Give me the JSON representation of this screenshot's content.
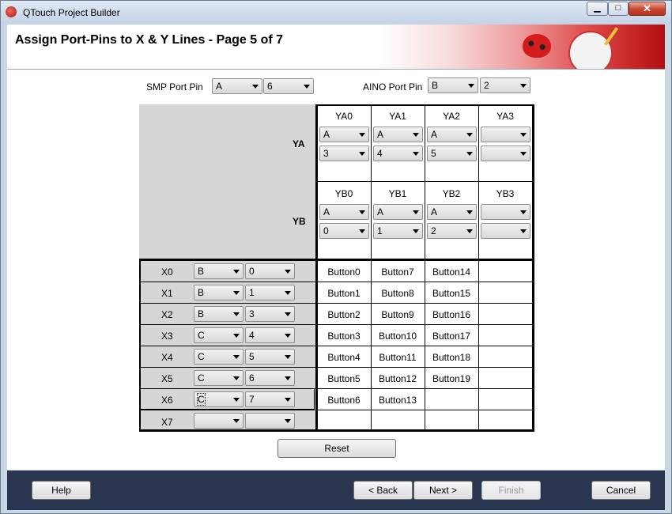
{
  "window": {
    "title": "QTouch Project Builder",
    "minimize": "▁",
    "maximize": "□",
    "close": "✕"
  },
  "header": {
    "title": "Assign Port-Pins to X & Y Lines - Page 5 of 7"
  },
  "smp": {
    "label": "SMP Port Pin",
    "port": "A",
    "pin": "6"
  },
  "aino": {
    "label": "AINO Port Pin",
    "port": "B",
    "pin": "2"
  },
  "ya": {
    "label": "YA",
    "columns": [
      {
        "name": "YA0",
        "port": "A",
        "pin": "3"
      },
      {
        "name": "YA1",
        "port": "A",
        "pin": "4"
      },
      {
        "name": "YA2",
        "port": "A",
        "pin": "5"
      },
      {
        "name": "YA3",
        "port": "",
        "pin": ""
      }
    ]
  },
  "yb": {
    "label": "YB",
    "columns": [
      {
        "name": "YB0",
        "port": "A",
        "pin": "0"
      },
      {
        "name": "YB1",
        "port": "A",
        "pin": "1"
      },
      {
        "name": "YB2",
        "port": "A",
        "pin": "2"
      },
      {
        "name": "YB3",
        "port": "",
        "pin": ""
      }
    ]
  },
  "x_rows": [
    {
      "name": "X0",
      "port": "B",
      "pin": "0",
      "cells": [
        "Button0",
        "Button7",
        "Button14",
        ""
      ]
    },
    {
      "name": "X1",
      "port": "B",
      "pin": "1",
      "cells": [
        "Button1",
        "Button8",
        "Button15",
        ""
      ]
    },
    {
      "name": "X2",
      "port": "B",
      "pin": "3",
      "cells": [
        "Button2",
        "Button9",
        "Button16",
        ""
      ]
    },
    {
      "name": "X3",
      "port": "C",
      "pin": "4",
      "cells": [
        "Button3",
        "Button10",
        "Button17",
        ""
      ]
    },
    {
      "name": "X4",
      "port": "C",
      "pin": "5",
      "cells": [
        "Button4",
        "Button11",
        "Button18",
        ""
      ]
    },
    {
      "name": "X5",
      "port": "C",
      "pin": "6",
      "cells": [
        "Button5",
        "Button12",
        "Button19",
        ""
      ]
    },
    {
      "name": "X6",
      "port": "C",
      "pin": "7",
      "cells": [
        "Button6",
        "Button13",
        "",
        ""
      ]
    },
    {
      "name": "X7",
      "port": "",
      "pin": "",
      "cells": [
        "",
        "",
        "",
        ""
      ]
    }
  ],
  "reset_label": "Reset",
  "footer": {
    "help": "Help",
    "back": "< Back",
    "next": "Next >",
    "finish": "Finish",
    "cancel": "Cancel"
  }
}
